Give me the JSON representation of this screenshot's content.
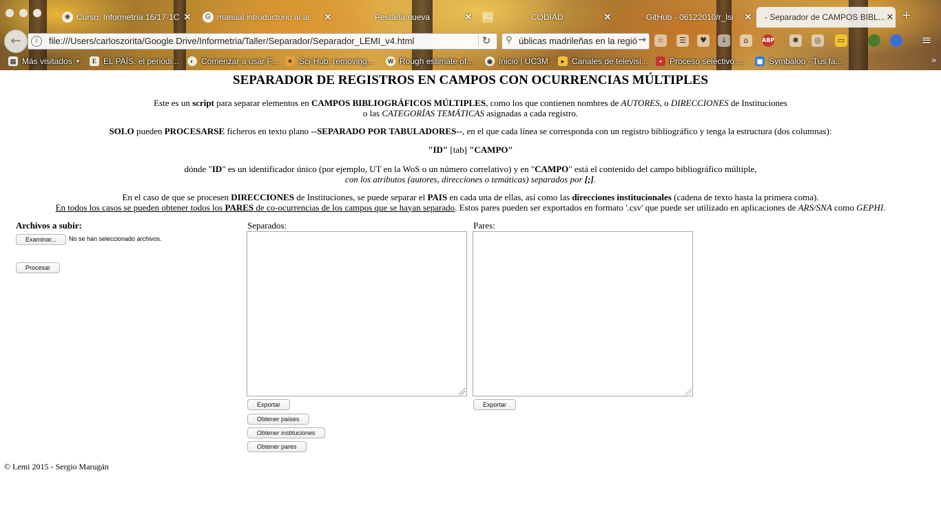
{
  "browser": {
    "tabs": [
      {
        "title": "Curso: Informetría 16/17-1C",
        "icon": "moodle-icon"
      },
      {
        "title": "manual introductorio al ar",
        "icon": "google-icon"
      },
      {
        "title": "Pestaña nueva",
        "icon": ""
      },
      {
        "title": "CODIAD",
        "icon": "codiad-icon"
      },
      {
        "title": "GitHub - 06122010/r_lsi",
        "icon": "github-icon"
      },
      {
        "title": "- Separador de CAMPOS BIBL...",
        "icon": ""
      }
    ],
    "url": "file:///Users/carloszorita/Google Drive/Informetria/Taller/Separador/Separador_LEMI_v4.html",
    "search_query": "úblicas madrileñas en la región",
    "bookmarks": [
      {
        "label": "Más visitados",
        "icon": "most-visited-icon"
      },
      {
        "label": "EL PAÍS: el periódi...",
        "icon": "elpais-icon"
      },
      {
        "label": "Comenzar a usar F...",
        "icon": "firefox-icon"
      },
      {
        "label": "Sci-Hub: removing...",
        "icon": "scihub-icon"
      },
      {
        "label": "Rough estimate of...",
        "icon": "wordpress-icon"
      },
      {
        "label": "Inicio | UC3M",
        "icon": "uc3m-icon"
      },
      {
        "label": "Canales de televisi...",
        "icon": "tv-icon"
      },
      {
        "label": "Proceso selectivo ...",
        "icon": "proceso-icon"
      },
      {
        "label": "Symbaloo - Tus fa...",
        "icon": "symbaloo-icon"
      }
    ],
    "abp_label": "ABP"
  },
  "page": {
    "title": "SEPARADOR DE REGISTROS EN CAMPOS CON OCURRENCIAS MÚLTIPLES",
    "intro": {
      "t1": "Este es un ",
      "b1": "script",
      "t2": " para separar elementos en ",
      "b2": "CAMPOS BIBLIOGRÁFICOS MÚLTIPLES",
      "t3": ", como los que contienen nombres de ",
      "i1": "AUTORES",
      "t4": ", o ",
      "i2": "DIRECCIONES",
      "t5": " de Instituciones",
      "t6": "o las ",
      "i3": "CATEGORÍAS TEMÁTICAS",
      "t7": " asignadas a cada registro."
    },
    "solo": {
      "b1": "SOLO",
      "t1": " pueden ",
      "b2": "PROCESARSE",
      "t2": " ficheros en texto plano ",
      "b3": "--SEPARADO POR TABULADORES--",
      "t3": ", en el que cada línea se corresponda con un registro bibliográfico y tenga la estructura (dos columnas):"
    },
    "structure": {
      "b1": "\"ID\"",
      "t1": " [tab] ",
      "b2": "\"CAMPO\""
    },
    "donde": {
      "t1": "dónde \"",
      "b1": "ID",
      "t2": "\" es un identificador único (por ejemplo, UT en la WoS o un número correlativo) y en \"",
      "b2": "CAMPO",
      "t3": "\" está el contenido del campo bibliográfico múltiple,",
      "i1": "con los atributos (autores, direcciones o temáticas) separados por ",
      "ib1": "[;]",
      "i2": "."
    },
    "caso": {
      "t1": "En el caso de que se procesen ",
      "b1": "DIRECCIONES",
      "t2": " de Instituciones, se puede separar el ",
      "b2": "PAIS",
      "t3": " en cada una de ellas, así como las ",
      "b3": "direcciones institucionales",
      "t4": " (cadena de texto hasta la primera coma).",
      "u1": "En todos los casos se pueden obtener todos los ",
      "ub1": "PARES",
      "u2": " de co-ocurrencias de los campos que se hayan separado",
      "t5": ". Estos pares pueden ser exportados en formato '.csv' que puede ser utilizado en aplicaciones de ",
      "i1": "ARS/SNA",
      "t6": " como ",
      "i2": "GEPHI",
      "t7": "."
    },
    "form": {
      "files_label": "Archivos a subir:",
      "browse_button": "Examinar...",
      "no_file_text": "No se han seleccionado archivos.",
      "process_button": "Procesar",
      "separados_label": "Separados:",
      "pares_label": "Pares:",
      "export_button": "Exportar",
      "export_pares_button": "Exportar",
      "paises_button": "Obtener países",
      "instituciones_button": "Obtener instituciones",
      "pares_button": "Obtener pares"
    },
    "footer": "© Lemi 2015 - Sergio Marugán"
  }
}
